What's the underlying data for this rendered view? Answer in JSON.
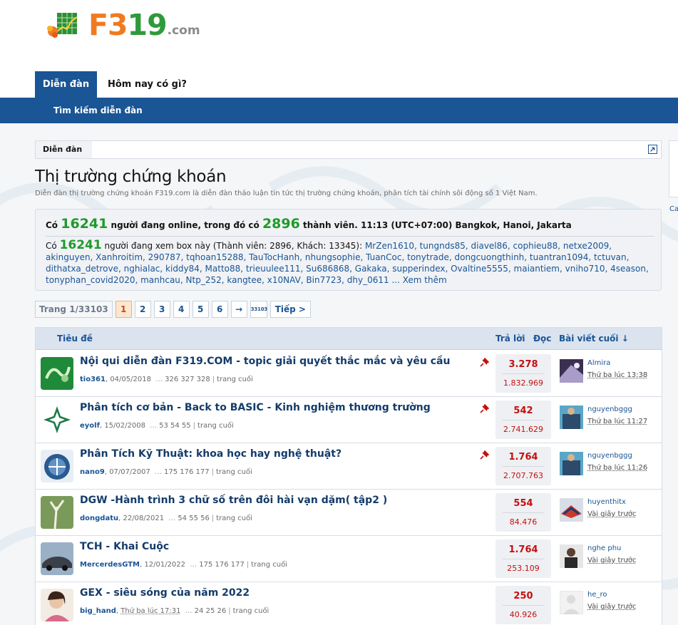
{
  "logo": {
    "brand_f": "F3",
    "brand_n": "19",
    "suffix": ".com"
  },
  "nav": {
    "tab_forums": "Diễn đàn",
    "tab_whats_new": "Hôm nay có gì?",
    "sub_search": "Tìm kiếm diễn đàn"
  },
  "breadcrumb": {
    "item": "Diễn đàn"
  },
  "side": {
    "text": "Ca"
  },
  "page": {
    "title": "Thị trường chứng khoán",
    "description": "Diễn đàn thị trường chứng khoán F319.com là diễn đàn thảo luận tin tức thị trường chứng khoán, phân tích tài chính sôi động số 1 Việt Nam."
  },
  "online": {
    "head_prefix": "Có",
    "online_count": "16241",
    "head_mid": "người đang online, trong đó có",
    "member_count": "2896",
    "head_suffix": "thành viên. 11:13 (UTC+07:00) Bangkok, Hanoi, Jakarta",
    "body_prefix": "Có",
    "viewing_count": "16241",
    "body_mid": "người đang xem box này (Thành viên: 2896, Khách: 13345):",
    "users": "MrZen1610, tungnds85, diavel86, cophieu88, netxe2009, akinguyen, Xanhroitim, 290787, tqhoan15288, TauTocHanh, nhungsophie, TuanCoc, tonytrade, dongcuongthinh, tuantran1094, tctuvan, dithatxa_detrove, nghialac, kiddy84, Matto88, trieuulee111, Su686868, Gakaka, supperindex, Ovaltine5555, maiantiem, vniho710, 4season, tonyphan_covid2020, manhcau, Ntp_252, kangtee, x10NAV, Bin7723, dhy_0611",
    "more": "... Xem thêm"
  },
  "pager": {
    "label": "Trang 1/33103",
    "pages": [
      "1",
      "2",
      "3",
      "4",
      "5",
      "6"
    ],
    "arrow": "→",
    "last": "33103",
    "next": "Tiếp >"
  },
  "table": {
    "col_title": "Tiêu đề",
    "col_replies": "Trả lời",
    "col_views": "Đọc",
    "col_last": "Bài viết cuối ↓"
  },
  "threads": [
    {
      "title": "Nội qui diễn đàn F319.COM - topic giải quyết thắc mắc và yêu cầu",
      "author": "tio361",
      "date": "04/05/2018",
      "pages": "326  327  328",
      "last_page": "trang cuối",
      "pinned": true,
      "replies": "3.278",
      "views": "1.832.969",
      "last_user": "Almira",
      "last_time": "Thứ ba lúc 13:38"
    },
    {
      "title": "Phân tích cơ bản - Back to BASIC - Kinh nghiệm thương trường",
      "author": "eyolf",
      "date": "15/02/2008",
      "pages": "53  54  55",
      "last_page": "trang cuối",
      "pinned": true,
      "replies": "542",
      "views": "2.741.629",
      "last_user": "nguyenbggg",
      "last_time": "Thứ ba lúc 11:27"
    },
    {
      "title": "Phân Tích Kỹ Thuật: khoa học hay nghệ thuật?",
      "author": "nano9",
      "date": "07/07/2007",
      "pages": "175  176  177",
      "last_page": "trang cuối",
      "pinned": true,
      "replies": "1.764",
      "views": "2.707.763",
      "last_user": "nguyenbggg",
      "last_time": "Thứ ba lúc 11:26"
    },
    {
      "title": "DGW -Hành trình 3 chữ số trên đôi hài vạn dặm( tập2 )",
      "author": "dongdatu",
      "date": "22/08/2021",
      "pages": "54  55  56",
      "last_page": "trang cuối",
      "pinned": false,
      "replies": "554",
      "views": "84.476",
      "last_user": "huyenthitx",
      "last_time": "Vài giây trước"
    },
    {
      "title": "TCH - Khai Cuộc",
      "author": "MercerdesGTM",
      "date": "12/01/2022",
      "pages": "175  176  177",
      "last_page": "trang cuối",
      "pinned": false,
      "replies": "1.764",
      "views": "253.109",
      "last_user": "nghe phu",
      "last_time": "Vài giây trước"
    },
    {
      "title": "GEX - siêu sóng của năm 2022",
      "author": "big_hand",
      "date": "Thứ ba lúc 17:31",
      "pages": "24  25  26",
      "last_page": "trang cuối",
      "pinned": false,
      "replies": "250",
      "views": "40.926",
      "last_user": "he_ro",
      "last_time": "Vài giây trước"
    }
  ],
  "colors": {
    "nav_blue": "#1a5595",
    "green": "#1f9a2a",
    "red": "#c41010",
    "orange": "#f07a21"
  }
}
